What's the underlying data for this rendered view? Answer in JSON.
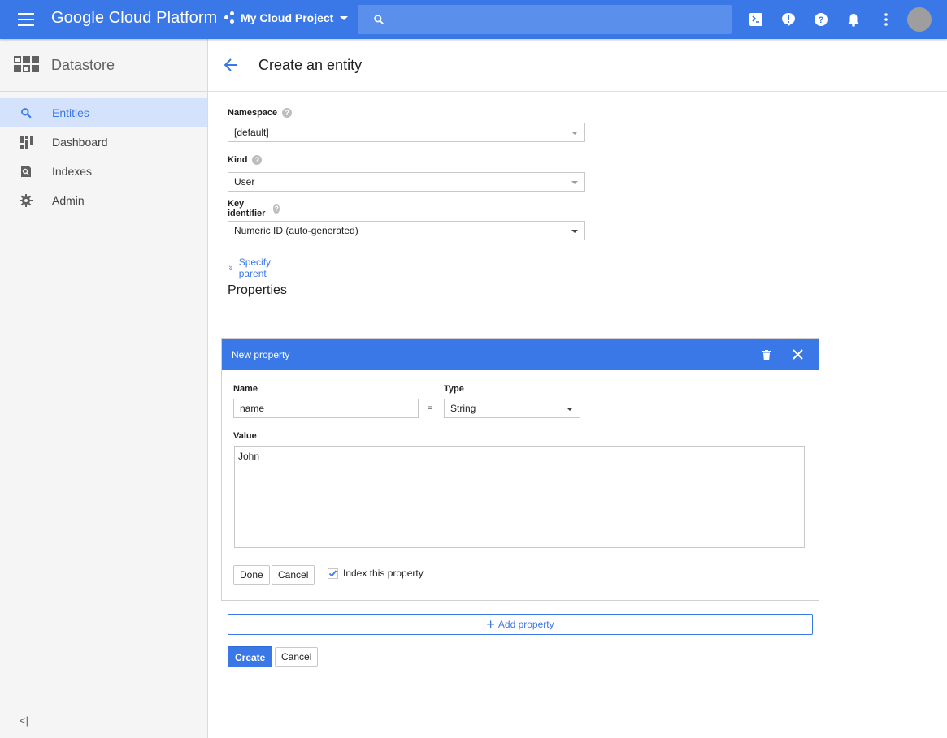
{
  "topbar": {
    "brand": "Google Cloud Platform",
    "project_name": "My Cloud Project",
    "search_placeholder": "",
    "icons": [
      "menu-icon",
      "project-dots-icon",
      "search-icon",
      "cloud-shell-icon",
      "notification-alert-icon",
      "help-icon",
      "bell-icon",
      "more-vert-icon",
      "avatar"
    ]
  },
  "sidebar": {
    "product": "Datastore",
    "items": [
      {
        "label": "Entities",
        "icon": "search-icon",
        "active": true
      },
      {
        "label": "Dashboard",
        "icon": "dashboard-icon",
        "active": false
      },
      {
        "label": "Indexes",
        "icon": "indexes-icon",
        "active": false
      },
      {
        "label": "Admin",
        "icon": "gear-icon",
        "active": false
      }
    ],
    "collapse_label": "<|"
  },
  "page": {
    "title": "Create an entity"
  },
  "form": {
    "namespace_label": "Namespace",
    "namespace_value": "[default]",
    "kind_label": "Kind",
    "kind_value": "User",
    "key_label": "Key identifier",
    "key_value": "Numeric ID (auto-generated)",
    "specify_parent": "Specify parent",
    "properties_title": "Properties"
  },
  "property": {
    "header": "New property",
    "name_label": "Name",
    "name_value": "name",
    "equals": "=",
    "type_label": "Type",
    "type_value": "String",
    "value_label": "Value",
    "value_text": "John",
    "done_label": "Done",
    "cancel_label": "Cancel",
    "index_label": "Index this property",
    "index_checked": true
  },
  "actions": {
    "add_property": "Add property",
    "create": "Create",
    "cancel": "Cancel"
  },
  "colors": {
    "brand_blue": "#3b78e7",
    "active_nav_bg": "#d4e2fb"
  }
}
